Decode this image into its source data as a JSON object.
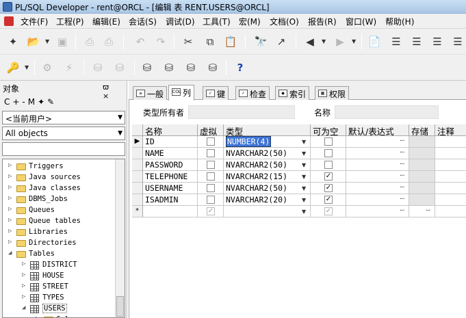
{
  "window": {
    "title": "PL/SQL Developer - rent@ORCL - [编辑 表 RENT.USERS@ORCL]"
  },
  "menu": [
    "文件(F)",
    "工程(P)",
    "编辑(E)",
    "会话(S)",
    "调试(D)",
    "工具(T)",
    "宏(M)",
    "文档(O)",
    "报告(R)",
    "窗口(W)",
    "帮助(H)"
  ],
  "toolbar_help_glyph": "?",
  "object_panel": {
    "title": "对象",
    "controls": "ϖ ×",
    "icon_glyphs": "C+-M✦✎",
    "owner_filter": "<当前用户>",
    "object_filter": "All objects",
    "tree": [
      {
        "label": "Triggers",
        "kind": "folder",
        "level": 0,
        "expanded": false
      },
      {
        "label": "Java sources",
        "kind": "folder",
        "level": 0,
        "expanded": false
      },
      {
        "label": "Java classes",
        "kind": "folder",
        "level": 0,
        "expanded": false
      },
      {
        "label": "DBMS_Jobs",
        "kind": "folder",
        "level": 0,
        "expanded": false
      },
      {
        "label": "Queues",
        "kind": "folder",
        "level": 0,
        "expanded": false
      },
      {
        "label": "Queue tables",
        "kind": "folder",
        "level": 0,
        "expanded": false
      },
      {
        "label": "Libraries",
        "kind": "folder",
        "level": 0,
        "expanded": false
      },
      {
        "label": "Directories",
        "kind": "folder",
        "level": 0,
        "expanded": false
      },
      {
        "label": "Tables",
        "kind": "folder",
        "level": 0,
        "expanded": true
      },
      {
        "label": "DISTRICT",
        "kind": "table",
        "level": 1,
        "expanded": false
      },
      {
        "label": "HOUSE",
        "kind": "table",
        "level": 1,
        "expanded": false
      },
      {
        "label": "STREET",
        "kind": "table",
        "level": 1,
        "expanded": false
      },
      {
        "label": "TYPES",
        "kind": "table",
        "level": 1,
        "expanded": false
      },
      {
        "label": "USERS",
        "kind": "table",
        "level": 1,
        "expanded": true,
        "selected": true
      },
      {
        "label": "Col",
        "kind": "folder",
        "level": 2,
        "expanded": false
      }
    ]
  },
  "editor": {
    "tabs": [
      {
        "label": "一般",
        "icon": "≡",
        "active": false
      },
      {
        "label": "列",
        "icon": "COL",
        "active": true
      },
      {
        "label": "键",
        "icon": "✓",
        "active": false
      },
      {
        "label": "检查",
        "icon": "✓",
        "active": false
      },
      {
        "label": "索引",
        "icon": "◆",
        "active": false
      },
      {
        "label": "权限",
        "icon": "▦",
        "active": false
      }
    ],
    "type_owner_label": "类型所有者",
    "type_owner_value": "",
    "name_label": "名称",
    "name_value": "",
    "columns_header": [
      "名称",
      "虚拟",
      "类型",
      "可为空",
      "默认/表达式",
      "存储",
      "注释"
    ],
    "ellipsis": "···",
    "rows": [
      {
        "name": "ID",
        "virtual": false,
        "type": "NUMBER(4)",
        "nullable": false,
        "current": true
      },
      {
        "name": "NAME",
        "virtual": false,
        "type": "NVARCHAR2(50)",
        "nullable": false
      },
      {
        "name": "PASSWORD",
        "virtual": false,
        "type": "NVARCHAR2(50)",
        "nullable": false
      },
      {
        "name": "TELEPHONE",
        "virtual": false,
        "type": "NVARCHAR2(15)",
        "nullable": true
      },
      {
        "name": "USERNAME",
        "virtual": false,
        "type": "NVARCHAR2(50)",
        "nullable": true
      },
      {
        "name": "ISADMIN",
        "virtual": false,
        "type": "NVARCHAR2(20)",
        "nullable": true
      }
    ],
    "new_row_marker": "*"
  }
}
